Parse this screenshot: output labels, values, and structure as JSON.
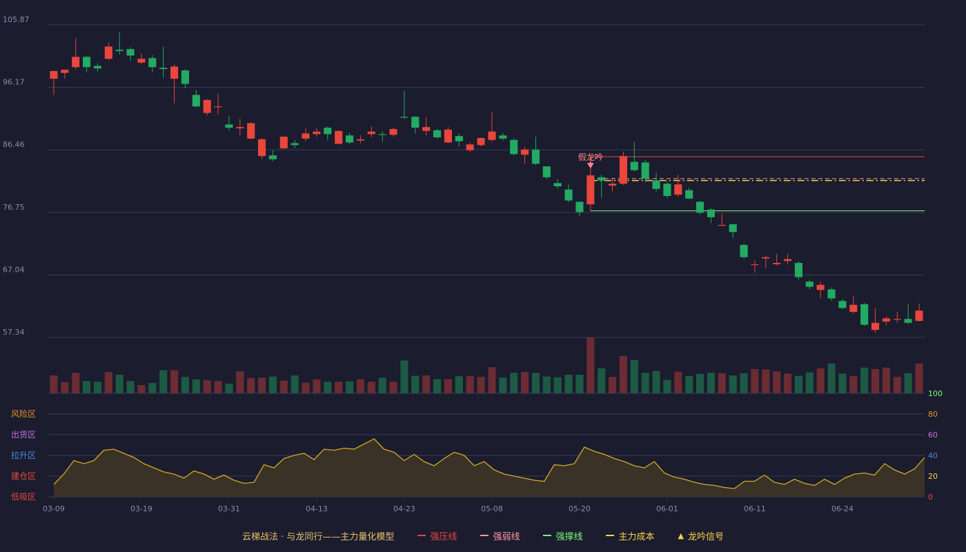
{
  "colors": {
    "background": "#1b1c2e",
    "grid": "#3a3c55",
    "axis_text": "#8a8ca8",
    "up": "#e9463c",
    "down": "#22ab62",
    "up_volume": "#6b2c33",
    "down_volume": "#1c5a44",
    "resistance": "#e9463c",
    "weak": "#ff9aa8",
    "support": "#7cf77c",
    "cost": "#ffd34a",
    "indicator_line": "#d4aa28",
    "indicator_fill": "#3a3226",
    "signal_text": "#ff8a8a",
    "right_tick_orange": "#e8902a",
    "right_tick_green": "#7cf77c",
    "legend_title": "#e8c26a"
  },
  "legend": {
    "title": "云梯战法 · 与龙同行——主力量化模型",
    "items": [
      {
        "label": "强压线",
        "color": "#e9463c",
        "kind": "solid"
      },
      {
        "label": "强弱线",
        "color": "#ff9aa8",
        "kind": "dash"
      },
      {
        "label": "强撑线",
        "color": "#7cf77c",
        "kind": "solid"
      },
      {
        "label": "主力成本",
        "color": "#ffd34a",
        "kind": "dash"
      },
      {
        "label": "龙吟信号",
        "color": "#ffd34a",
        "kind": "triangle"
      }
    ]
  },
  "chart_data": {
    "type": "candlestick",
    "y_ticks": [
      "105.87",
      "96.17",
      "86.46",
      "76.75",
      "67.04",
      "57.34"
    ],
    "ylim": [
      57.34,
      105.87
    ],
    "x_ticks": [
      {
        "label": "03-09",
        "index": 0
      },
      {
        "label": "03-19",
        "index": 8
      },
      {
        "label": "03-31",
        "index": 16
      },
      {
        "label": "04-13",
        "index": 24
      },
      {
        "label": "04-23",
        "index": 32
      },
      {
        "label": "05-08",
        "index": 40
      },
      {
        "label": "05-20",
        "index": 48
      },
      {
        "label": "06-01",
        "index": 56
      },
      {
        "label": "06-11",
        "index": 64
      },
      {
        "label": "06-24",
        "index": 72
      }
    ],
    "candles": [
      [
        97.5,
        98.7,
        95.0,
        98.7
      ],
      [
        98.4,
        98.9,
        97.5,
        98.9
      ],
      [
        99.3,
        100.9,
        103.8,
        99.0
      ],
      [
        100.9,
        99.3,
        101.0,
        98.5
      ],
      [
        99.5,
        99.1,
        99.9,
        98.6
      ],
      [
        100.6,
        102.5,
        103.1,
        100.4
      ],
      [
        102.0,
        101.8,
        104.7,
        101.3
      ],
      [
        102.1,
        101.1,
        102.4,
        100.3
      ],
      [
        100.0,
        100.6,
        101.4,
        99.8
      ],
      [
        100.7,
        99.3,
        101.2,
        98.5
      ],
      [
        99.2,
        99.0,
        102.5,
        97.6
      ],
      [
        97.5,
        99.4,
        99.7,
        93.7
      ],
      [
        98.8,
        96.7,
        99.0,
        96.0
      ],
      [
        95.0,
        93.2,
        95.8,
        93.1
      ],
      [
        92.2,
        94.2,
        94.4,
        91.8
      ],
      [
        93.1,
        93.2,
        95.2,
        91.9
      ],
      [
        90.4,
        89.9,
        91.7,
        89.4
      ],
      [
        89.8,
        90.0,
        91.3,
        88.7
      ],
      [
        88.2,
        90.6,
        90.7,
        88.1
      ],
      [
        85.5,
        88.1,
        88.3,
        85.0
      ],
      [
        85.6,
        85.0,
        86.4,
        84.7
      ],
      [
        86.7,
        88.5,
        88.6,
        86.6
      ],
      [
        87.5,
        87.2,
        88.0,
        86.7
      ],
      [
        88.2,
        89.0,
        89.8,
        87.8
      ],
      [
        88.9,
        89.3,
        89.8,
        88.5
      ],
      [
        89.9,
        88.9,
        90.1,
        87.9
      ],
      [
        87.4,
        89.4,
        89.5,
        87.3
      ],
      [
        88.7,
        87.6,
        89.1,
        87.4
      ],
      [
        87.9,
        88.1,
        88.7,
        87.5
      ],
      [
        88.9,
        89.3,
        90.1,
        88.4
      ],
      [
        88.9,
        88.8,
        89.3,
        87.7
      ],
      [
        88.8,
        89.7,
        89.9,
        88.5
      ],
      [
        91.6,
        91.5,
        95.6,
        91.3
      ],
      [
        91.6,
        89.9,
        91.7,
        89.0
      ],
      [
        89.4,
        90.0,
        91.5,
        88.7
      ],
      [
        89.5,
        88.4,
        89.7,
        88.2
      ],
      [
        87.6,
        89.6,
        90.0,
        87.5
      ],
      [
        88.6,
        87.8,
        89.0,
        87.0
      ],
      [
        86.4,
        87.3,
        87.6,
        86.1
      ],
      [
        87.2,
        88.3,
        88.4,
        87.0
      ],
      [
        88.0,
        89.3,
        92.3,
        87.7
      ],
      [
        88.7,
        88.2,
        89.1,
        87.9
      ],
      [
        88.0,
        85.8,
        88.3,
        85.6
      ],
      [
        85.7,
        86.5,
        86.9,
        84.3
      ],
      [
        86.5,
        84.3,
        88.5,
        84.1
      ],
      [
        83.9,
        82.2,
        83.9,
        81.9
      ],
      [
        81.3,
        80.8,
        81.9,
        80.4
      ],
      [
        80.3,
        78.6,
        81.1,
        78.3
      ],
      [
        78.4,
        76.8,
        78.4,
        76.2
      ],
      [
        78.0,
        82.5,
        82.5,
        78.0
      ],
      [
        82.2,
        81.7,
        82.6,
        79.0
      ],
      [
        80.9,
        81.2,
        81.9,
        80.0
      ],
      [
        81.2,
        85.5,
        86.2,
        81.0
      ],
      [
        84.6,
        83.3,
        87.7,
        83.1
      ],
      [
        84.5,
        82.0,
        84.9,
        81.4
      ],
      [
        81.7,
        80.4,
        82.9,
        80.0
      ],
      [
        81.2,
        79.3,
        81.5,
        79.0
      ],
      [
        79.5,
        81.1,
        82.6,
        79.2
      ],
      [
        80.2,
        78.9,
        80.6,
        78.8
      ],
      [
        78.4,
        76.7,
        78.5,
        76.4
      ],
      [
        77.2,
        76.0,
        77.4,
        75.1
      ],
      [
        74.8,
        74.8,
        76.5,
        74.7
      ],
      [
        74.9,
        73.7,
        75.0,
        72.8
      ],
      [
        71.7,
        69.8,
        71.9,
        69.6
      ],
      [
        68.6,
        68.7,
        69.3,
        67.4
      ],
      [
        69.6,
        69.8,
        70.0,
        68.1
      ],
      [
        68.7,
        68.9,
        70.3,
        68.5
      ],
      [
        69.2,
        69.5,
        70.3,
        68.7
      ],
      [
        68.9,
        66.7,
        69.2,
        66.3
      ],
      [
        66.0,
        65.2,
        66.3,
        64.8
      ],
      [
        64.7,
        65.5,
        66.0,
        63.4
      ],
      [
        64.8,
        63.4,
        65.1,
        63.0
      ],
      [
        63.0,
        61.9,
        63.3,
        61.7
      ],
      [
        61.3,
        62.4,
        63.8,
        61.0
      ],
      [
        62.5,
        59.3,
        62.7,
        59.1
      ],
      [
        58.5,
        59.6,
        61.9,
        58.0
      ],
      [
        59.8,
        60.3,
        60.6,
        59.2
      ],
      [
        60.1,
        60.2,
        61.3,
        59.6
      ],
      [
        60.2,
        59.6,
        62.5,
        59.4
      ],
      [
        59.9,
        61.5,
        62.6,
        59.8
      ]
    ],
    "volume": [
      48,
      30,
      55,
      33,
      31,
      57,
      50,
      33,
      22,
      28,
      62,
      62,
      44,
      37,
      35,
      33,
      26,
      59,
      41,
      42,
      45,
      34,
      48,
      29,
      37,
      31,
      31,
      32,
      38,
      31,
      42,
      31,
      88,
      47,
      48,
      38,
      38,
      46,
      46,
      44,
      70,
      42,
      55,
      57,
      55,
      45,
      43,
      50,
      50,
      150,
      67,
      44,
      100,
      89,
      55,
      60,
      36,
      58,
      46,
      52,
      55,
      54,
      48,
      54,
      65,
      64,
      59,
      53,
      47,
      56,
      67,
      80,
      53,
      46,
      69,
      65,
      69,
      44,
      54,
      80
    ],
    "main_force": [
      12,
      22,
      35,
      32,
      35,
      45,
      46,
      42,
      38,
      32,
      28,
      24,
      22,
      18,
      25,
      22,
      17,
      21,
      16,
      13,
      14,
      31,
      28,
      37,
      40,
      42,
      36,
      46,
      45,
      47,
      46,
      51,
      56,
      46,
      43,
      35,
      41,
      34,
      30,
      37,
      43,
      40,
      30,
      34,
      26,
      22,
      20,
      18,
      16,
      15,
      31,
      30,
      32,
      48,
      44,
      41,
      37,
      34,
      30,
      28,
      34,
      23,
      19,
      17,
      14,
      12,
      11,
      9,
      8,
      15,
      15,
      21,
      14,
      12,
      17,
      13,
      11,
      17,
      12,
      18,
      22,
      23,
      21,
      32,
      26,
      22,
      27,
      38
    ]
  },
  "indicator_panel": {
    "zones_left": [
      {
        "label": "风险区",
        "color": "#e8902a"
      },
      {
        "label": "出货区",
        "color": "#c66fe0"
      },
      {
        "label": "拉升区",
        "color": "#4c88d9"
      },
      {
        "label": "建仓区",
        "color": "#e9463c"
      },
      {
        "label": "低吸区",
        "color": "#e9463c"
      }
    ],
    "right_ticks": [
      "100",
      "80",
      "60",
      "40",
      "20",
      "0"
    ]
  },
  "overlays": {
    "signal_label": "假龙吟",
    "signal_index": 49,
    "resistance": 85.4,
    "weak_line": 82.0,
    "cost_line": 81.7,
    "support": 77.0
  }
}
